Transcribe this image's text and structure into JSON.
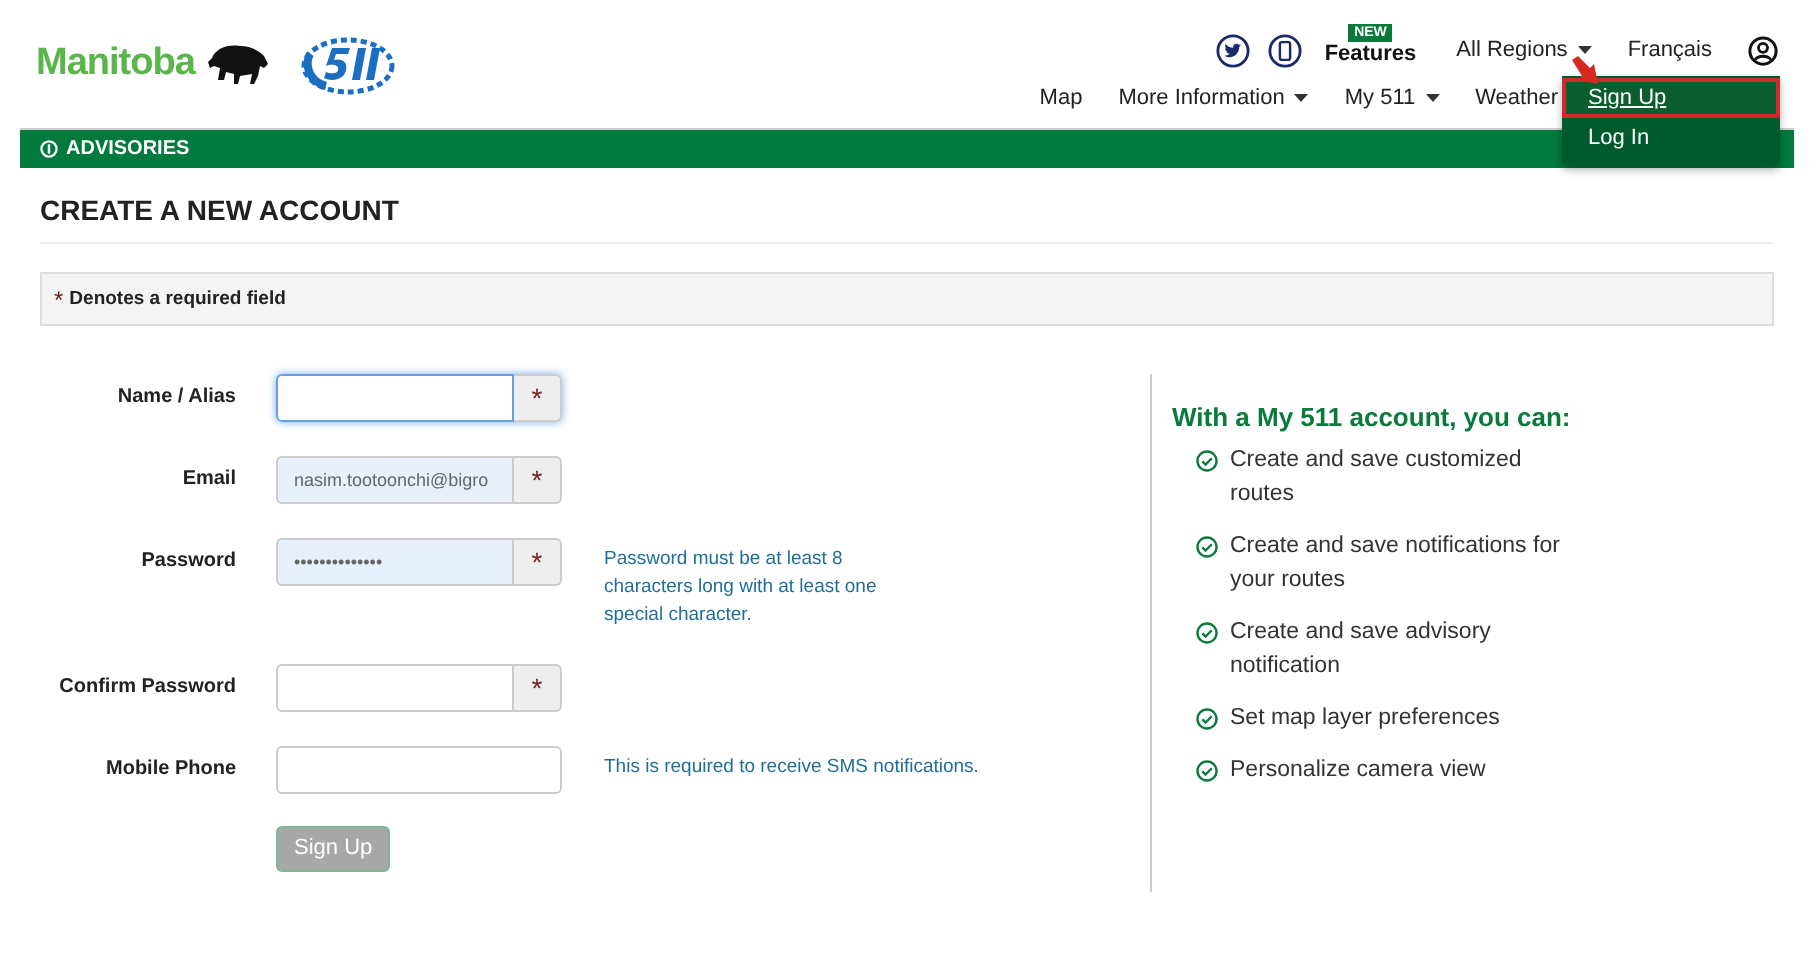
{
  "header": {
    "logo_text": "Manitoba",
    "badge": "NEW",
    "features": "Features",
    "regions": "All Regions",
    "language": "Français",
    "nav": [
      {
        "label": "Map",
        "has_menu": false
      },
      {
        "label": "More Information",
        "has_menu": true
      },
      {
        "label": "My 511",
        "has_menu": true
      },
      {
        "label": "Weather",
        "has_menu": false
      }
    ],
    "dropdown": [
      {
        "label": "Sign Up",
        "selected": true
      },
      {
        "label": "Log In",
        "selected": false
      }
    ]
  },
  "advisories": "ADVISORIES",
  "page_title": "CREATE A NEW ACCOUNT",
  "required_note": "Denotes a required field",
  "required_mark": "*",
  "fields": [
    {
      "label": "Name / Alias",
      "required": true,
      "focused": true,
      "autofilled": false
    },
    {
      "label": "Email",
      "value": "nasim.tootoonchi@bigro",
      "required": true,
      "focused": false,
      "autofilled": true
    },
    {
      "label": "Password",
      "value": "••••••••••••••",
      "required": true,
      "focused": false,
      "autofilled": true,
      "help": "Password must be at least 8 characters long with at least one special character."
    },
    {
      "label": "Confirm Password",
      "required": true,
      "focused": false,
      "autofilled": false
    },
    {
      "label": "Mobile Phone",
      "required": false,
      "focused": false,
      "autofilled": false,
      "help": "This is required to receive SMS notifications."
    }
  ],
  "submit": {
    "label": "Sign Up",
    "disabled": true
  },
  "benefits": {
    "title": "With a My 511 account, you can:",
    "items": [
      "Create and save customized routes",
      "Create and save notifications for your routes",
      "Create and save advisory notification",
      "Set map layer preferences",
      "Personalize camera view"
    ]
  }
}
